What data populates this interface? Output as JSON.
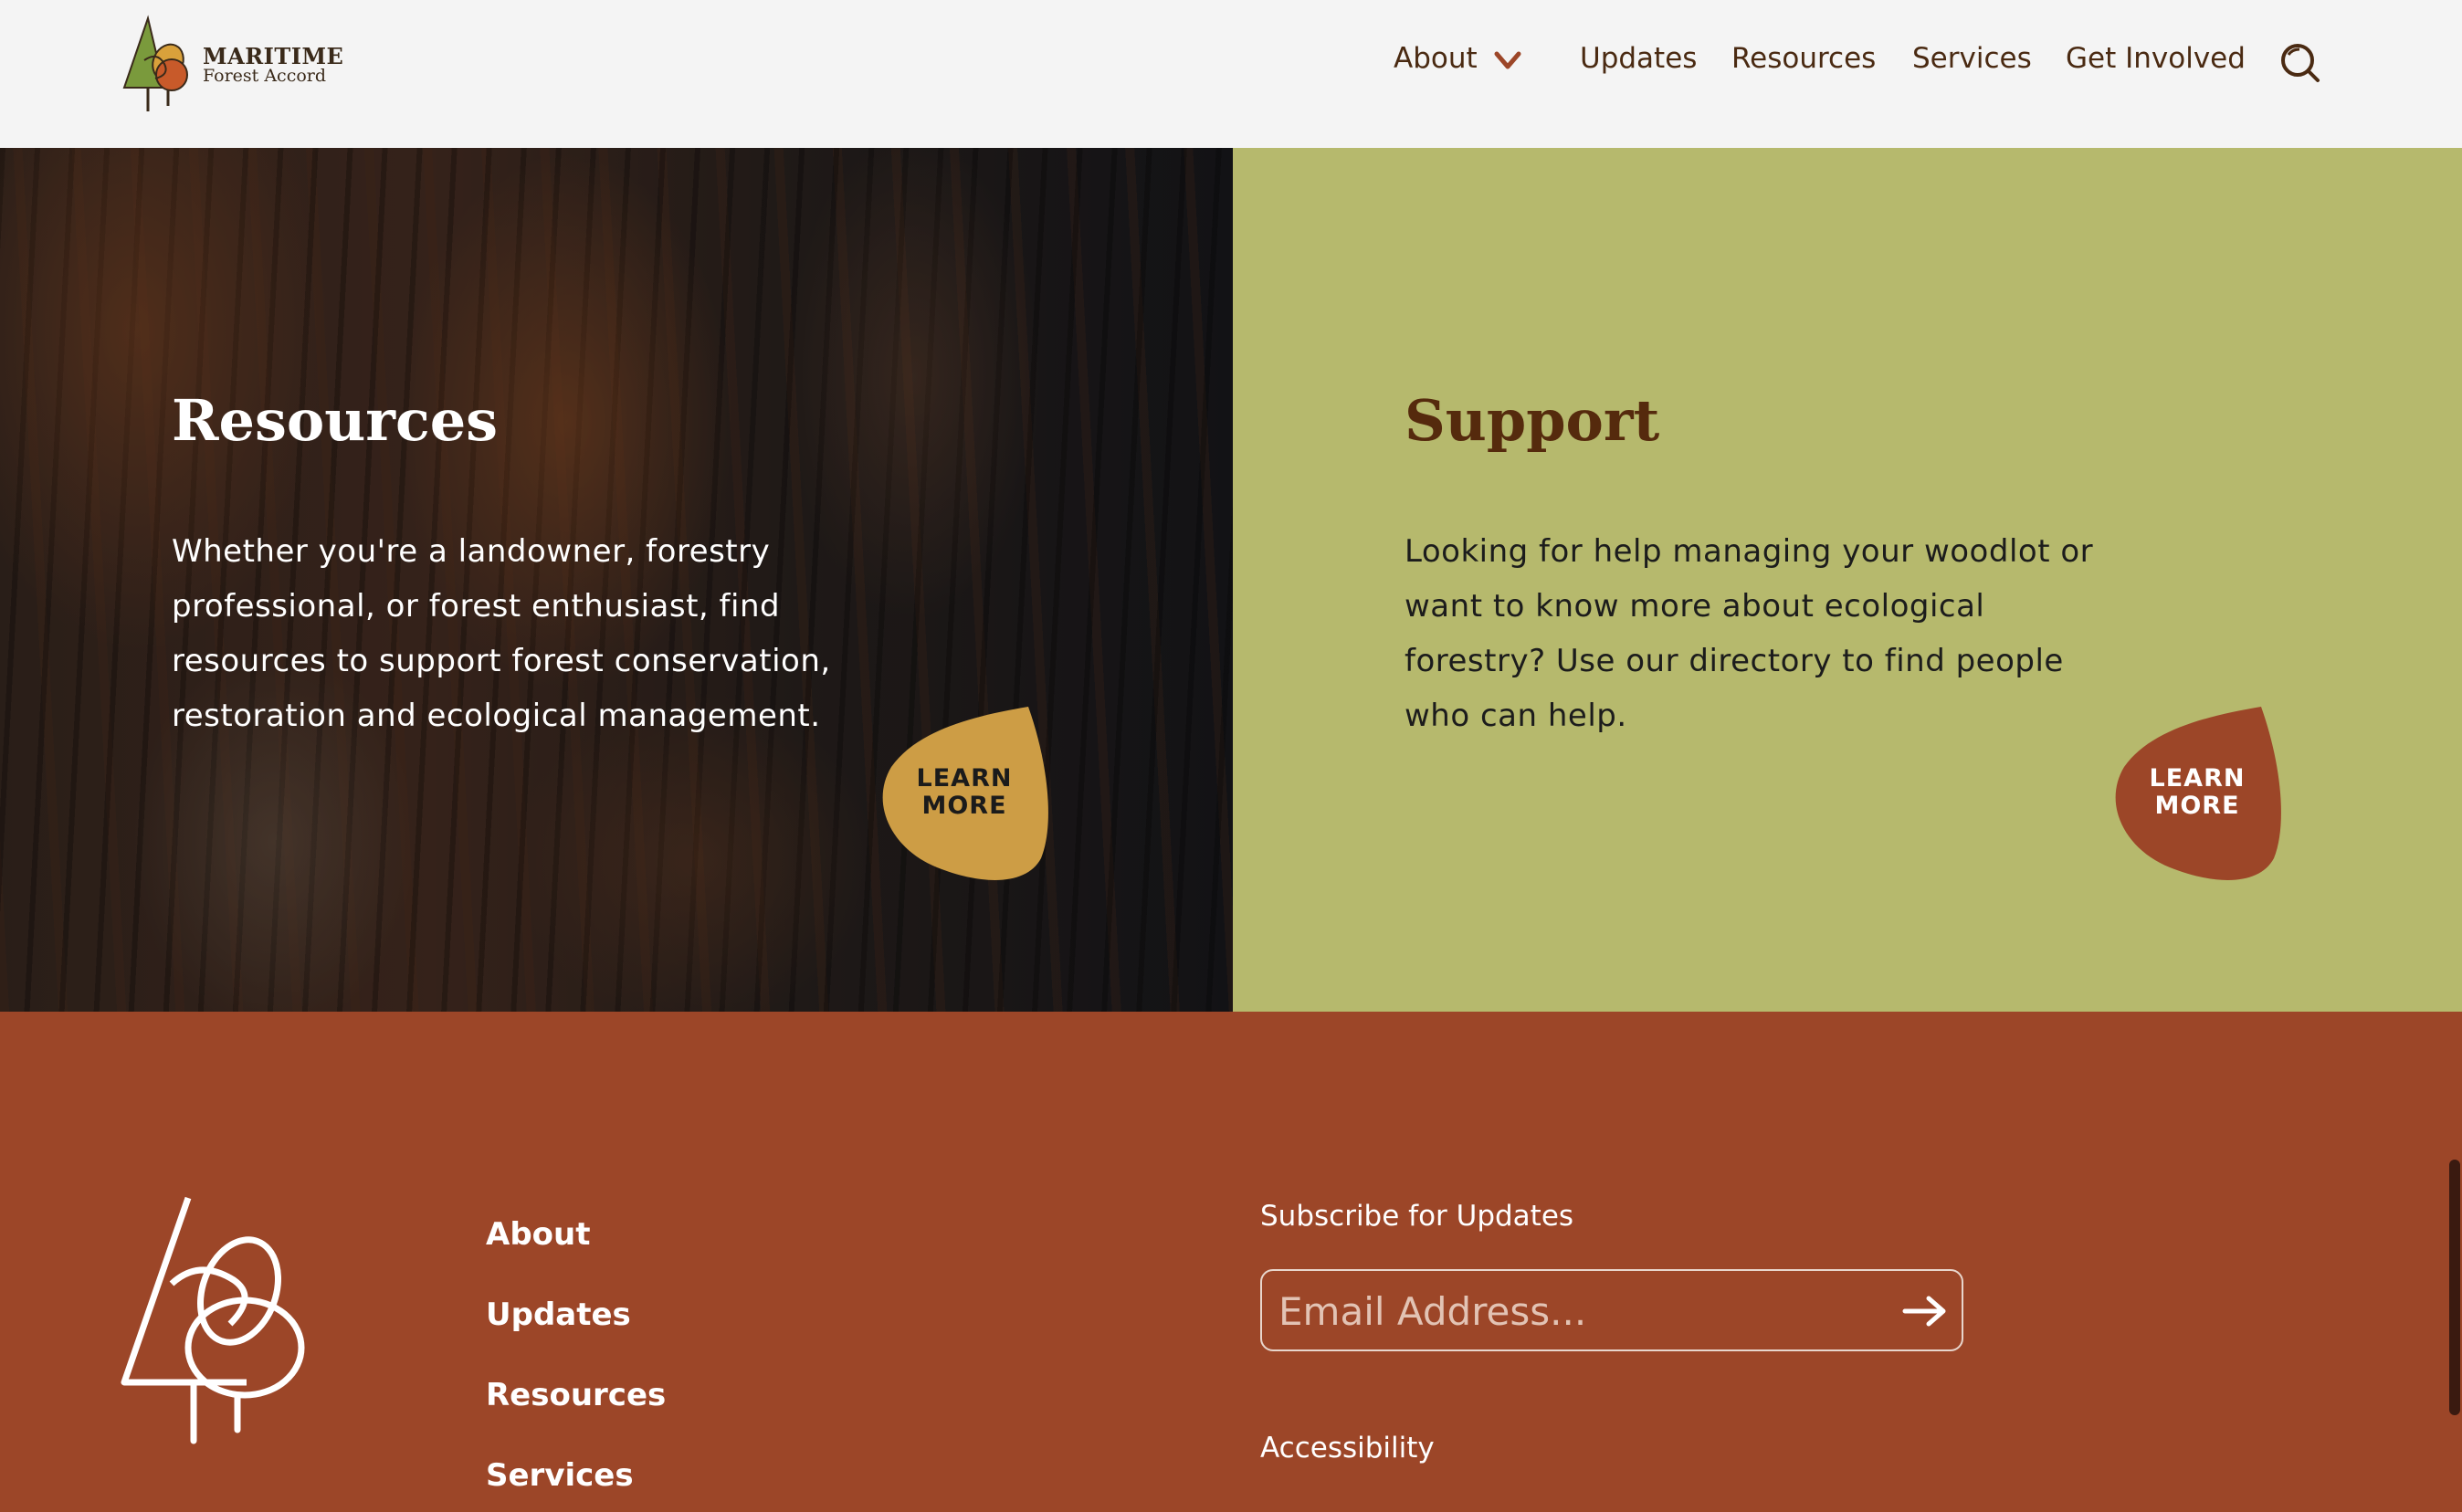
{
  "header": {
    "logo_line1": "MARITIME",
    "logo_line2": "Forest Accord",
    "nav": {
      "about": "About",
      "updates": "Updates",
      "resources": "Resources",
      "services": "Services",
      "get_involved": "Get Involved"
    }
  },
  "resources_panel": {
    "title": "Resources",
    "text": "Whether you're a landowner, forestry professional, or forest enthusiast, find resources to support forest conservation, restoration and ecological management.",
    "button_line1": "LEARN",
    "button_line2": "MORE"
  },
  "support_panel": {
    "title": "Support",
    "text": "Looking for help managing your woodlot or want to know more about ecological forestry? Use our directory to find people who can help.",
    "button_line1": "LEARN",
    "button_line2": "MORE"
  },
  "footer": {
    "links": [
      "About",
      "Updates",
      "Resources",
      "Services"
    ],
    "subscribe_label": "Subscribe for Updates",
    "email_placeholder": "Email Address...",
    "accessibility": "Accessibility"
  },
  "colors": {
    "header_bg": "#f4f4f4",
    "nav_text": "#4a2a12",
    "accent_rust": "#9c4628",
    "olive_panel": "#b6b96d",
    "gold_button": "#cd9d45",
    "support_title": "#552a0d"
  },
  "icons": {
    "logo": "tree-leaves-logo-icon",
    "nav_dropdown": "chevron-down-icon",
    "search": "search-icon",
    "submit": "arrow-right-icon"
  }
}
